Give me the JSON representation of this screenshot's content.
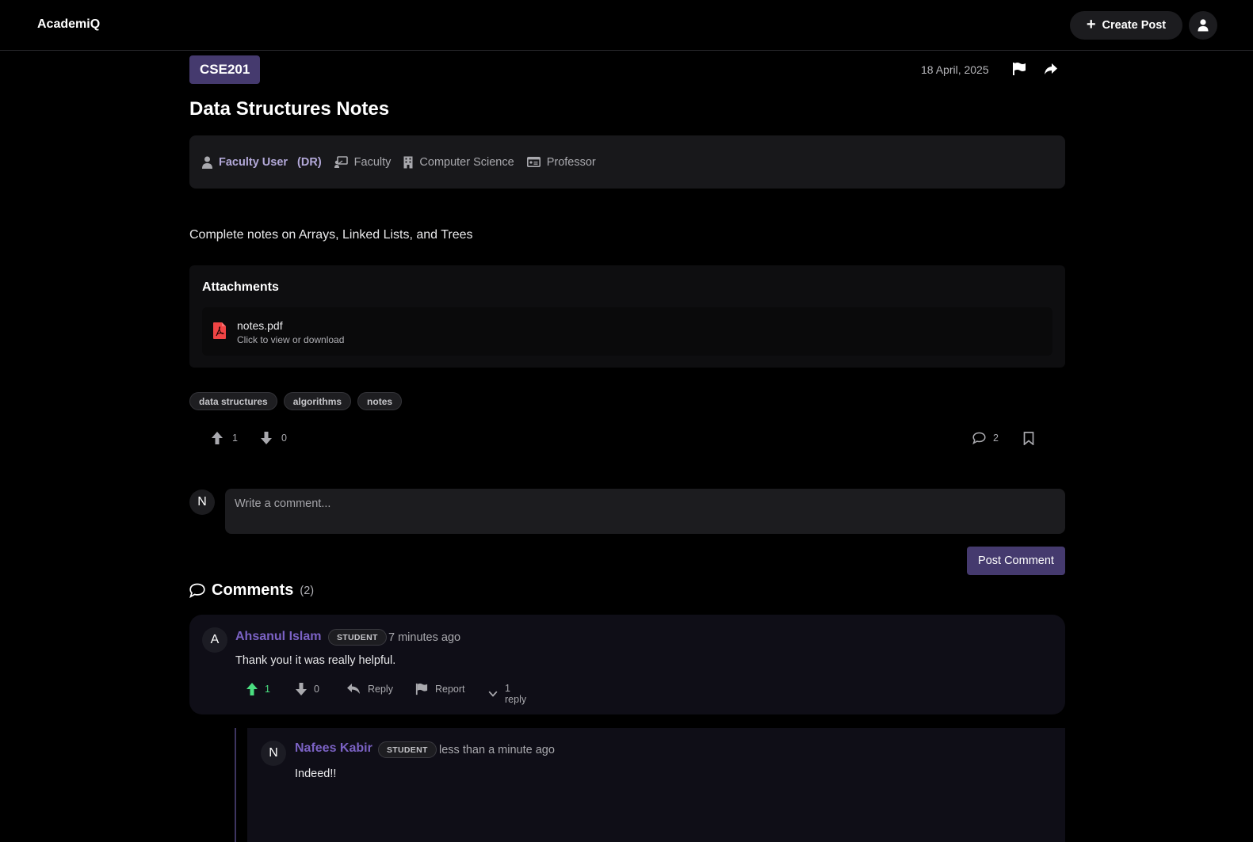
{
  "nav": {
    "brand": "AcademiQ",
    "create_post_label": "Create Post"
  },
  "post": {
    "course_code": "CSE201",
    "date": "18 April, 2025",
    "title": "Data Structures Notes",
    "author": {
      "name": "Faculty User",
      "abbr": "(DR)",
      "role": "Faculty",
      "department": "Computer Science",
      "designation": "Professor"
    },
    "description": "Complete notes on Arrays, Linked Lists, and Trees",
    "attachments": {
      "heading": "Attachments",
      "files": [
        {
          "name": "notes.pdf",
          "hint": "Click to view or download",
          "icon": "pdf-file-icon"
        }
      ]
    },
    "tags": [
      "data structures",
      "algorithms",
      "notes"
    ],
    "upvotes": "1",
    "downvotes": "0",
    "comment_count": "2"
  },
  "comment_form": {
    "avatar_initial": "N",
    "placeholder": "Write a comment...",
    "submit_label": "Post Comment"
  },
  "comments_section": {
    "heading": "Comments",
    "count": "(2)",
    "items": [
      {
        "initial": "A",
        "author": "Ahsanul Islam",
        "role": "STUDENT",
        "time": "7 minutes ago",
        "text": "Thank you! it was really helpful.",
        "upvotes": "1",
        "downvotes": "0",
        "reply_label": "Reply",
        "report_label": "Report",
        "replies_toggle": "1 reply",
        "replies": [
          {
            "initial": "N",
            "author": "Nafees Kabir",
            "role": "STUDENT",
            "time": "less than a minute ago",
            "text": "Indeed!!"
          }
        ]
      }
    ]
  },
  "colors": {
    "accent": "#453a6e",
    "author_name": "#7b62c4",
    "upvote_active": "#4ade80",
    "pdf_icon": "#ef4444"
  }
}
